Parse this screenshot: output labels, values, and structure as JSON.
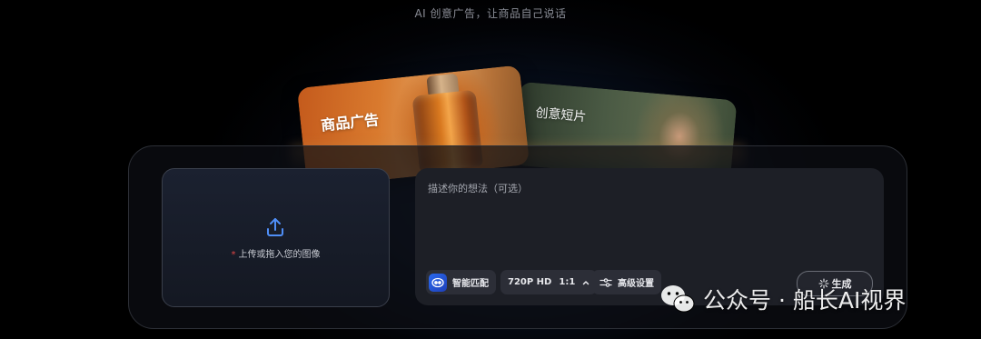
{
  "header": {
    "tagline": "AI 创意广告，让商品自己说话"
  },
  "cards": {
    "product_ad": "商品广告",
    "creative_short": "创意短片"
  },
  "upload": {
    "required_mark": "*",
    "label": "上传或拖入您的图像"
  },
  "prompt": {
    "placeholder": "描述你的想法（可选）",
    "value": ""
  },
  "toolbar": {
    "smart_match_label": "智能匹配",
    "resolution": "720P HD",
    "aspect_ratio": "1:1",
    "advanced_label": "高级设置",
    "generate_label": "生成"
  },
  "watermark": {
    "text": "公众号 · 船长AI视界"
  },
  "icons": {
    "upload": "upload-icon",
    "smart_match": "smart-match-icon",
    "chevron": "chevron-up-icon",
    "advanced": "sliders-icon",
    "generate": "sparkle-icon",
    "watermark": "wechat-icon"
  },
  "colors": {
    "accent_blue": "#2a6af0",
    "required": "#e04545",
    "panel_bg": "#1d1f26"
  }
}
